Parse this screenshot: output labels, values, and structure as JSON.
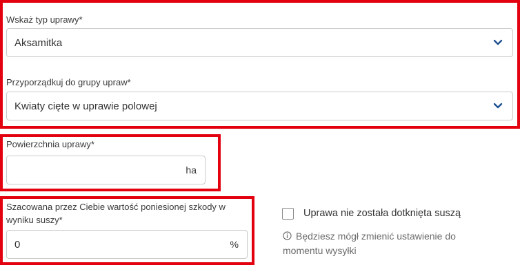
{
  "crop_type": {
    "label": "Wskaż typ uprawy*",
    "value": "Aksamitka"
  },
  "crop_group": {
    "label": "Przyporządkuj do grupy upraw*",
    "value": "Kwiaty cięte w uprawie polowej"
  },
  "area": {
    "label": "Powierzchnia uprawy*",
    "value": "",
    "unit": "ha"
  },
  "damage": {
    "label_line1": "Szacowana przez Ciebie wartość poniesionej szkody w",
    "label_line2": "wyniku suszy*",
    "value": "0",
    "unit": "%"
  },
  "drought_checkbox": {
    "label": "Uprawa nie została dotknięta suszą",
    "checked": false
  },
  "info_note": {
    "line1": "Będziesz mógł zmienić ustawienie do",
    "line2": "momentu wysyłki"
  },
  "colors": {
    "highlight": "#e3000f",
    "chevron": "#1d4f91"
  },
  "icons": {
    "select_chevron": "chevron-down-icon",
    "info": "info-icon"
  }
}
